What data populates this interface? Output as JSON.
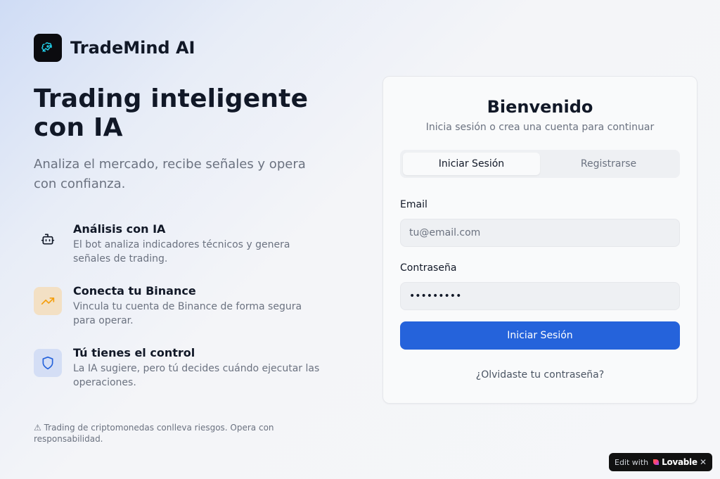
{
  "brand": {
    "name": "TradeMind AI",
    "logo_icon": "brain-chart-icon"
  },
  "hero": {
    "title": "Trading inteligente con IA",
    "subtitle": "Analiza el mercado, recibe señales y opera con confianza."
  },
  "features": [
    {
      "icon": "robot-icon",
      "title": "Análisis con IA",
      "description": "El bot analiza indicadores técnicos y genera señales de trading."
    },
    {
      "icon": "trending-up-icon",
      "title": "Conecta tu Binance",
      "description": "Vincula tu cuenta de Binance de forma segura para operar."
    },
    {
      "icon": "shield-icon",
      "title": "Tú tienes el control",
      "description": "La IA sugiere, pero tú decides cuándo ejecutar las operaciones."
    }
  ],
  "disclaimer": "⚠ Trading de criptomonedas conlleva riesgos. Opera con responsabilidad.",
  "auth": {
    "title": "Bienvenido",
    "subtitle": "Inicia sesión o crea una cuenta para continuar",
    "tabs": [
      {
        "label": "Iniciar Sesión",
        "active": true
      },
      {
        "label": "Registrarse",
        "active": false
      }
    ],
    "email": {
      "label": "Email",
      "placeholder": "tu@email.com",
      "value": ""
    },
    "password": {
      "label": "Contraseña",
      "value": "password1"
    },
    "submit_label": "Iniciar Sesión",
    "forgot_label": "¿Olvidaste tu contraseña?"
  },
  "lovable_badge": {
    "prefix": "Edit with",
    "brand": "Lovable",
    "close": "✕"
  },
  "colors": {
    "primary": "#2563db",
    "trend_icon": "#f59e0b",
    "shield_icon": "#2563db",
    "logo_accent": "#22d3ee"
  }
}
